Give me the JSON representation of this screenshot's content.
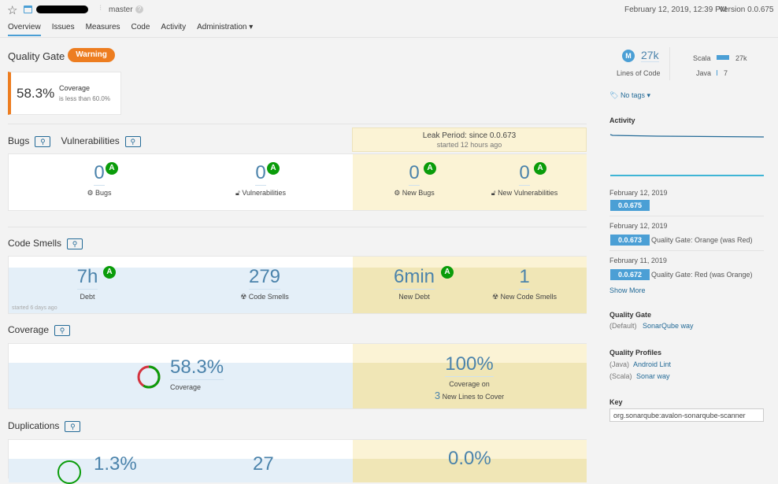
{
  "header": {
    "branch": "master",
    "date": "February 12, 2019, 12:39 PM",
    "version": "Version 0.0.675"
  },
  "nav": {
    "tabs": [
      {
        "label": "Overview",
        "active": true
      },
      {
        "label": "Issues"
      },
      {
        "label": "Measures"
      },
      {
        "label": "Code"
      },
      {
        "label": "Activity"
      },
      {
        "label": "Administration ▾"
      }
    ]
  },
  "quality_gate": {
    "title": "Quality Gate",
    "status": "Warning",
    "status_color": "#ed7d20",
    "condition_value": "58.3%",
    "condition_metric": "Coverage",
    "condition_text": "is less than 60.0%"
  },
  "leak_period": {
    "title": "Leak Period: since 0.0.673",
    "started": "started 12 hours ago"
  },
  "bugs_section": {
    "bugs_title": "Bugs",
    "vuln_title": "Vulnerabilities",
    "bugs": {
      "value": "0",
      "rating": "A",
      "label": "Bugs"
    },
    "vulnerabilities": {
      "value": "0",
      "rating": "A",
      "label": "Vulnerabilities"
    },
    "new_bugs": {
      "value": "0",
      "rating": "A",
      "label": "New Bugs"
    },
    "new_vulnerabilities": {
      "value": "0",
      "rating": "A",
      "label": "New Vulnerabilities"
    }
  },
  "code_smells": {
    "title": "Code Smells",
    "debt": {
      "value": "7h",
      "rating": "A",
      "label": "Debt"
    },
    "smells": {
      "value": "279",
      "label": "Code Smells"
    },
    "new_debt": {
      "value": "6min",
      "rating": "A",
      "label": "New Debt"
    },
    "new_smells": {
      "value": "1",
      "label": "New Code Smells"
    },
    "started": "started 6 days ago"
  },
  "coverage": {
    "title": "Coverage",
    "value": "58.3%",
    "label": "Coverage",
    "percent": 58.3,
    "new_value": "100%",
    "new_label": "Coverage on",
    "new_lines": "3",
    "new_lines_label": "New Lines to Cover"
  },
  "duplications": {
    "title": "Duplications",
    "value": "1.3%",
    "blocks": "27",
    "new_value": "0.0%"
  },
  "sidebar": {
    "size_letter": "M",
    "loc": "27k",
    "loc_label": "Lines of Code",
    "languages": [
      {
        "name": "Scala",
        "value": "27k"
      },
      {
        "name": "Java",
        "value": "7"
      }
    ],
    "tags": "No tags ▾",
    "activity_title": "Activity",
    "events": [
      {
        "date": "February 12, 2019",
        "version": "0.0.675",
        "text": ""
      },
      {
        "date": "February 12, 2019",
        "version": "0.0.673",
        "text": "Quality Gate: Orange (was Red)"
      },
      {
        "date": "February 11, 2019",
        "version": "0.0.672",
        "text": "Quality Gate: Red (was Orange)"
      }
    ],
    "show_more": "Show More",
    "qg_title": "Quality Gate",
    "qg_default": "(Default)",
    "qg_name": "SonarQube way",
    "qp_title": "Quality Profiles",
    "profiles": [
      {
        "lang": "(Java)",
        "name": "Android Lint"
      },
      {
        "lang": "(Scala)",
        "name": "Sonar way"
      }
    ],
    "key_title": "Key",
    "key_value": "org.sonarqube:avalon-sonarqube-scanner"
  }
}
